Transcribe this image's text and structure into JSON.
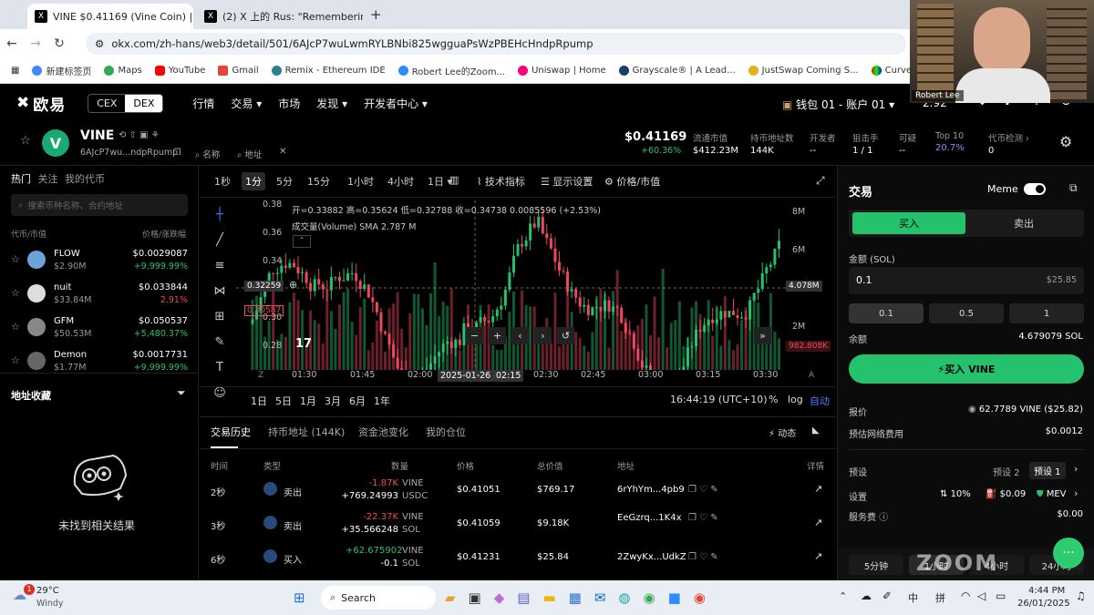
{
  "browser": {
    "tabs": [
      {
        "label": "VINE $0.41169 (Vine Coin) | Sol",
        "fav": "X"
      },
      {
        "label": "(2) X 上的 Rus: \"Remembering",
        "fav": "X"
      }
    ],
    "new_tab": "+",
    "url": "okx.com/zh-hans/web3/detail/501/6AJcP7wuLwmRYLBNbi825wgguaPsWzPBEHcHndpRpump",
    "bookmarks": [
      "新建标签页",
      "Maps",
      "YouTube",
      "Gmail",
      "Remix - Ethereum IDE",
      "Robert Lee的Zoom...",
      "Uniswap | Home",
      "Grayscale® | A Lead...",
      "JustSwap Coming S...",
      "Curve.fi"
    ]
  },
  "header": {
    "logo": "欧易",
    "cex": "CEX",
    "dex": "DEX",
    "nav": [
      "行情",
      "交易 ▾",
      "市场",
      "发现 ▾",
      "开发者中心 ▾"
    ],
    "wallet": "钱包 01 - 账户 01 ▾",
    "balance": "2.92",
    "webcam_name": "Robert Lee"
  },
  "token": {
    "symbol": "VINE",
    "address": "6AJcP7wu...ndpRpump",
    "name_link": "名称",
    "addr_link": "地址",
    "price": "$0.41169",
    "change": "+60.36%",
    "stats": [
      {
        "label": "流通市值",
        "value": "$412.23M"
      },
      {
        "label": "持币地址数",
        "value": "144K"
      },
      {
        "label": "开发者",
        "value": "--"
      },
      {
        "label": "狙击手",
        "value": "1 / 1"
      },
      {
        "label": "可疑",
        "value": "--"
      },
      {
        "label": "Top 10",
        "value": "20.7%"
      },
      {
        "label": "代币检测 ›",
        "value": "0"
      }
    ]
  },
  "left": {
    "tabs": [
      "热门",
      "关注",
      "我的代币"
    ],
    "search_placeholder": "搜索币种名称、合约地址",
    "col1": "代币/市值",
    "col2": "价格/涨跌幅",
    "tokens": [
      {
        "name": "FLOW",
        "cap": "$2.90M",
        "price": "$0.0029087",
        "chg": "+9,999.99%",
        "up": true
      },
      {
        "name": "nuit",
        "cap": "$33.84M",
        "price": "$0.033844",
        "chg": "2.91%",
        "up": false
      },
      {
        "name": "GFM",
        "cap": "$50.53M",
        "price": "$0.050537",
        "chg": "+5,480.37%",
        "up": true
      },
      {
        "name": "Demon",
        "cap": "$1.77M",
        "price": "$0.0017731",
        "chg": "+9,999.99%",
        "up": true
      }
    ],
    "fav_title": "地址收藏",
    "empty": "未找到相关结果"
  },
  "chart": {
    "intervals": [
      "1秒",
      "1分",
      "5分",
      "15分",
      "1小时",
      "4小时",
      "1日 ▾"
    ],
    "indicator": "技术指标",
    "settings": "显示设置",
    "pricecap": "价格/市值",
    "ohlc": "开=0.33882 高=0.35624 低=0.32788 收=0.34738 0.0085596 (+2.53%)",
    "volume": "成交量(Volume) SMA 2.787 M",
    "price_ticks": [
      "0.38",
      "0.36",
      "0.34",
      "0.32",
      "0.30",
      "0.28"
    ],
    "vol_ticks": [
      "8M",
      "6M",
      "4M",
      "2M"
    ],
    "crosshair_price": "0.32259",
    "red_price": "0.30587",
    "vol_marker": "4.078M",
    "vol_red": "982.808K",
    "time_ticks": [
      "01:30",
      "01:45",
      "02:00",
      "2025-01-26",
      "02:15",
      "02:30",
      "02:45",
      "03:00",
      "03:15",
      "03:30"
    ],
    "ranges": [
      "1日",
      "5日",
      "1月",
      "3月",
      "6月",
      "1年"
    ],
    "clock": "16:44:19 (UTC+10)",
    "pct": "%",
    "log": "log",
    "auto": "自动"
  },
  "history": {
    "tabs": [
      "交易历史",
      "持币地址 (144K)",
      "资金池变化",
      "我的仓位"
    ],
    "dyn": "动态",
    "headers": [
      "时间",
      "类型",
      "数量",
      "价格",
      "总价值",
      "地址",
      "详情"
    ],
    "rows": [
      {
        "t": "2秒",
        "type": "卖出",
        "q1": "-1.87K",
        "s1": "VINE",
        "q2": "+769.24993",
        "s2": "USDC",
        "price": "$0.41051",
        "total": "$769.17",
        "addr": "6rYhYm...4pb9"
      },
      {
        "t": "3秒",
        "type": "卖出",
        "q1": "-22.37K",
        "s1": "VINE",
        "q2": "+35.566248",
        "s2": "SOL",
        "price": "$0.41059",
        "total": "$9.18K",
        "addr": "EeGzrq...1K4x"
      },
      {
        "t": "6秒",
        "type": "买入",
        "q1": "+62.675902",
        "s1": "VINE",
        "q2": "-0.1",
        "s2": "SOL",
        "price": "$0.41231",
        "total": "$25.84",
        "addr": "2ZwyKx...UdkZ"
      }
    ]
  },
  "trade": {
    "title": "交易",
    "meme": "Meme",
    "buy": "买入",
    "sell": "卖出",
    "amount_label": "金额 (SOL)",
    "amount": "0.1",
    "amount_usd": "$25.85",
    "presets": [
      "0.1",
      "0.5",
      "1"
    ],
    "balance_label": "余额",
    "balance": "4.679079 SOL",
    "buy_btn": "买入 VINE",
    "quote_label": "报价",
    "quote": "62.7789 VINE ($25.82)",
    "fee_label": "预估网络费用",
    "fee": "$0.0012",
    "preset_label": "预设",
    "preset2": "预设 2",
    "preset1": "预设 1",
    "settings_label": "设置",
    "slip": "10%",
    "gas": "$0.09",
    "mev": "MEV",
    "service_label": "服务费",
    "service": "$0.00",
    "times": [
      "5分钟",
      "1小时",
      "4小时",
      "24小时"
    ]
  },
  "taskbar": {
    "temp": "29°C",
    "weather": "Windy",
    "search": "Search",
    "lang": "中",
    "ime": "拼",
    "time": "4:44 PM",
    "date": "26/01/2025",
    "badge": "1"
  },
  "chart_data": {
    "type": "candlestick",
    "x": [
      "01:30",
      "01:45",
      "02:00",
      "02:15",
      "02:30",
      "02:45",
      "03:00",
      "03:15",
      "03:30"
    ],
    "ylim": [
      0.27,
      0.38
    ],
    "volume_ylim": [
      0,
      9000000
    ]
  }
}
